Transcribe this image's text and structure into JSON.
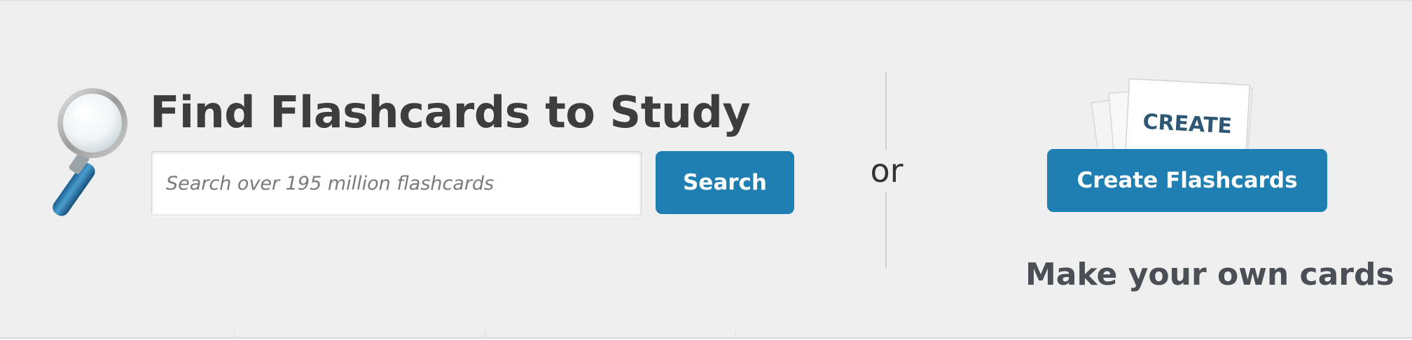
{
  "find": {
    "title": "Find Flashcards to Study",
    "search_placeholder": "Search over 195 million flashcards",
    "search_value": "",
    "search_button": "Search"
  },
  "or_label": "or",
  "create": {
    "card_label": "CREATE",
    "button_label": "Create Flashcards",
    "subtitle": "Make your own cards"
  },
  "colors": {
    "accent": "#1f7fb2",
    "background": "#efefef",
    "title_text": "#3d3d3d"
  },
  "icons": [
    "magnifying-glass-icon",
    "create-cards-icon"
  ]
}
